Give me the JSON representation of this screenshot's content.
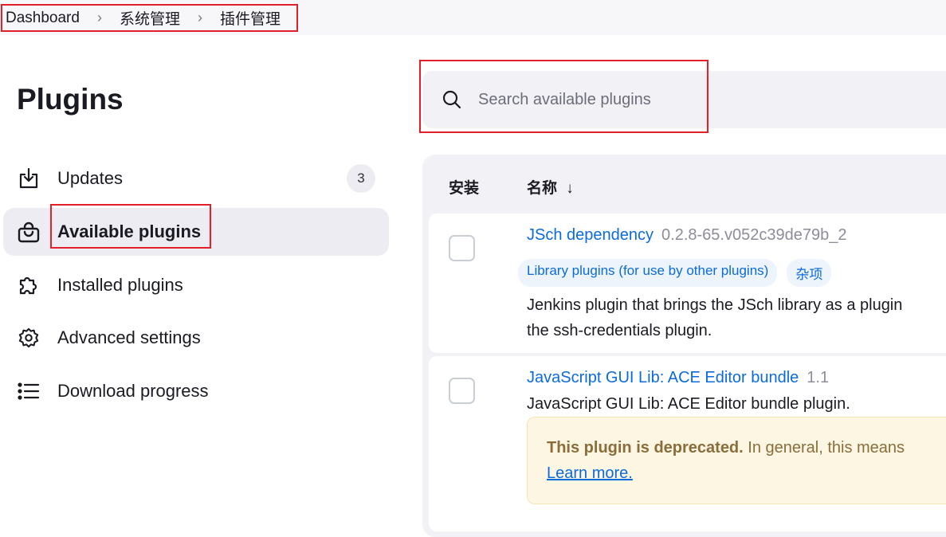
{
  "breadcrumb": [
    "Dashboard",
    "系统管理",
    "插件管理"
  ],
  "page_title": "Plugins",
  "sidebar": {
    "items": [
      {
        "label": "Updates",
        "icon": "download-icon",
        "badge": "3"
      },
      {
        "label": "Available plugins",
        "icon": "shopping-bag-icon",
        "active": true
      },
      {
        "label": "Installed plugins",
        "icon": "puzzle-icon"
      },
      {
        "label": "Advanced settings",
        "icon": "gear-icon"
      },
      {
        "label": "Download progress",
        "icon": "list-icon"
      }
    ]
  },
  "search": {
    "placeholder": "Search available plugins",
    "value": ""
  },
  "table": {
    "headers": {
      "install": "安装",
      "name": "名称",
      "sort": "↓"
    },
    "rows": [
      {
        "name": "JSch dependency",
        "version": "0.2.8-65.v052c39de79b_2",
        "tags": [
          "Library plugins (for use by other plugins)",
          "杂项"
        ],
        "description": [
          "Jenkins plugin that brings the JSch library as a plugin",
          "the ssh-credentials plugin."
        ],
        "checked": false
      },
      {
        "name": "JavaScript GUI Lib: ACE Editor bundle",
        "version": "1.1",
        "description": [
          "JavaScript GUI Lib: ACE Editor bundle plugin."
        ],
        "warning": {
          "bold": "This plugin is deprecated.",
          "text": " In general, this means",
          "link": "Learn more."
        },
        "checked": false
      }
    ]
  },
  "colors": {
    "accent": "#0b6bdc",
    "highlight": "#e3202a",
    "warning_bg": "#fcf6e2"
  }
}
